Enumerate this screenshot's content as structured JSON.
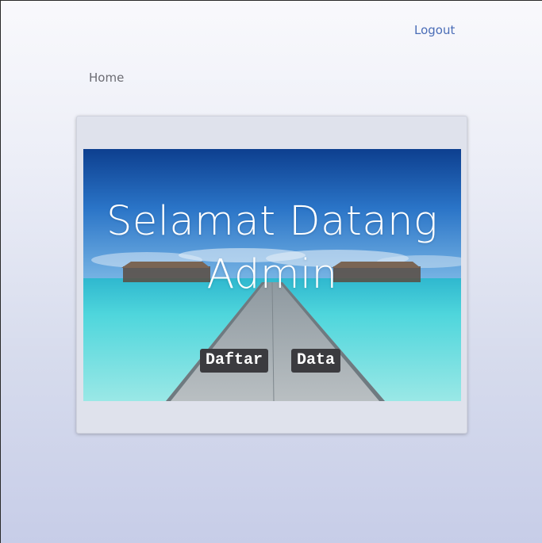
{
  "nav": {
    "logout_label": "Logout",
    "home_label": "Home"
  },
  "hero": {
    "title": "Selamat Datang Admin",
    "buttons": [
      {
        "label": "Daftar"
      },
      {
        "label": "Data"
      }
    ]
  },
  "colors": {
    "link_blue": "#4a6db7",
    "button_bg": "#3b3b3f",
    "card_bg": "#dfe2ec",
    "sea_turquoise": "#3fd0d8",
    "sky_blue": "#1f5fb0"
  }
}
